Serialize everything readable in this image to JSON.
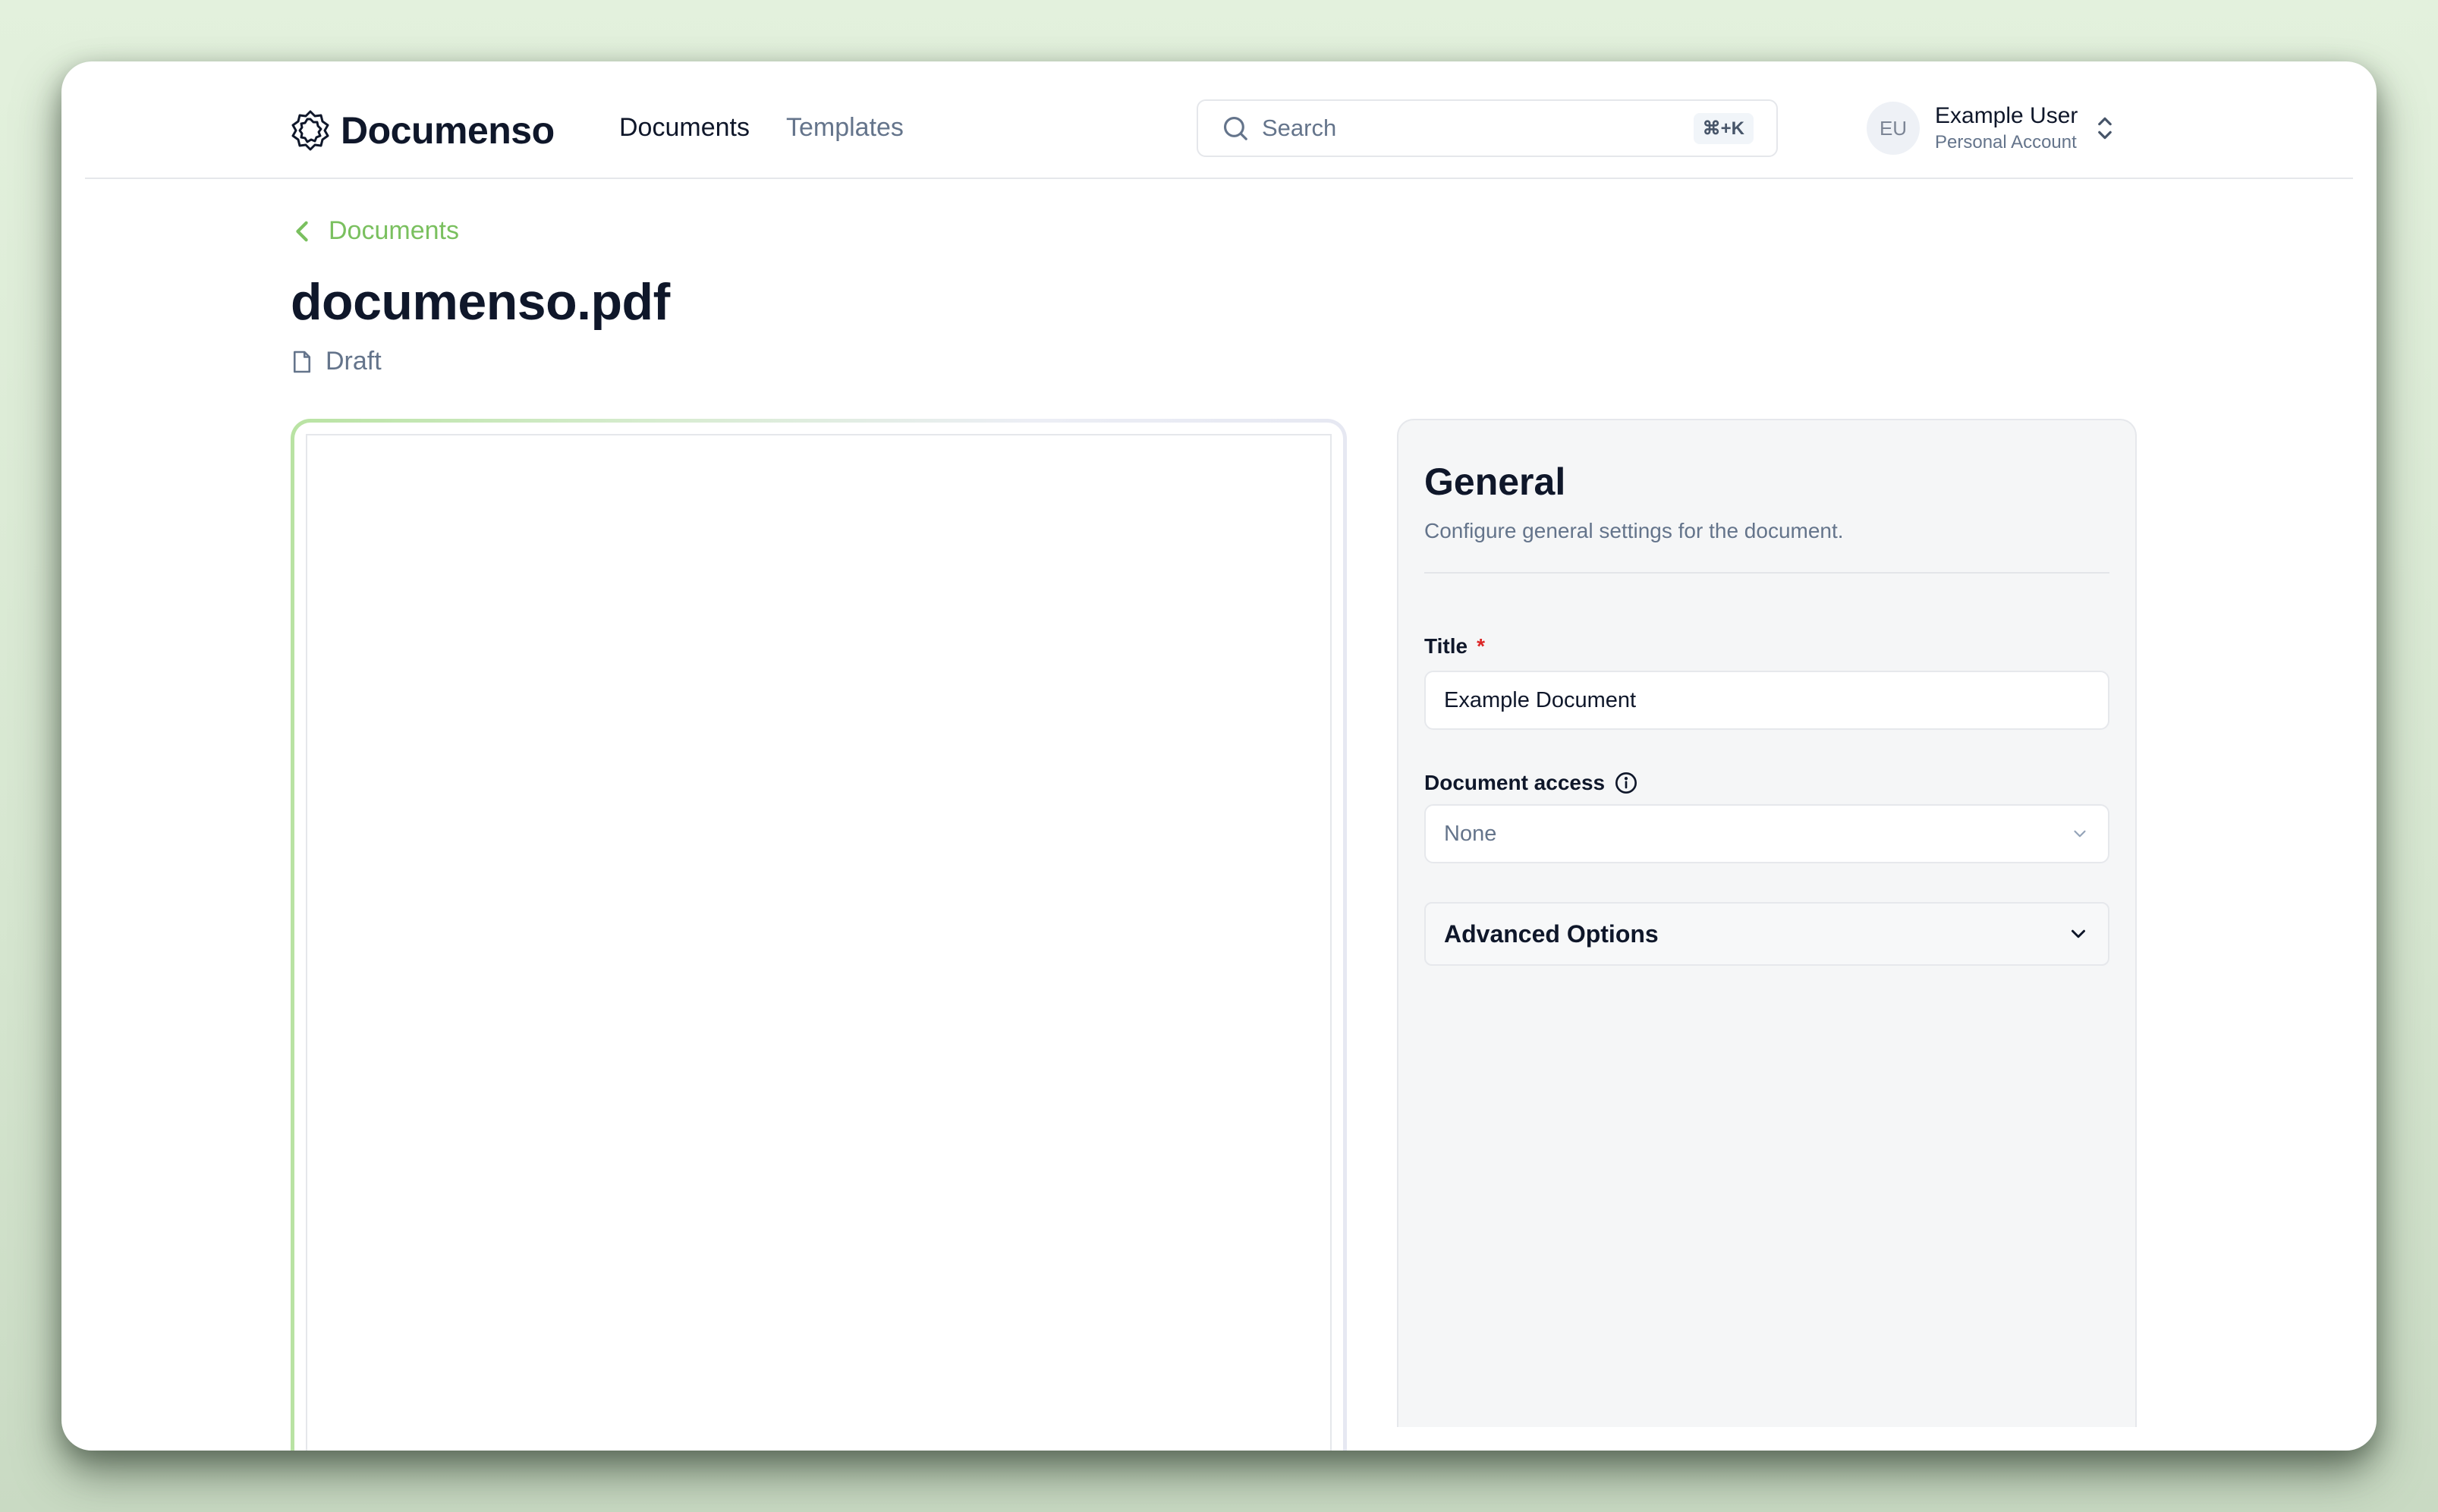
{
  "app": {
    "brand": "Documenso"
  },
  "nav": {
    "items": [
      {
        "label": "Documents",
        "active": true
      },
      {
        "label": "Templates",
        "active": false
      }
    ]
  },
  "search": {
    "placeholder": "Search",
    "shortcut": "⌘+K",
    "icon": "search-icon"
  },
  "user": {
    "initials": "EU",
    "name": "Example User",
    "account": "Personal Account",
    "switch_icon": "chevrons-up-down-icon"
  },
  "breadcrumb": {
    "back_label": "Documents",
    "icon": "chevron-left-icon"
  },
  "document": {
    "title": "documenso.pdf",
    "status": "Draft",
    "status_icon": "file-icon"
  },
  "panel": {
    "title": "General",
    "description": "Configure general settings for the document.",
    "fields": {
      "title_label": "Title",
      "title_required_mark": "*",
      "title_value": "Example Document",
      "access_label": "Document access",
      "access_info_icon": "info-icon",
      "access_value": "None"
    },
    "advanced_label": "Advanced Options"
  },
  "colors": {
    "accent_green": "#7ac05f",
    "required_red": "#dc2626",
    "panel_bg": "#f5f6f7",
    "text_primary": "#0f172a",
    "text_muted": "#64748b"
  }
}
